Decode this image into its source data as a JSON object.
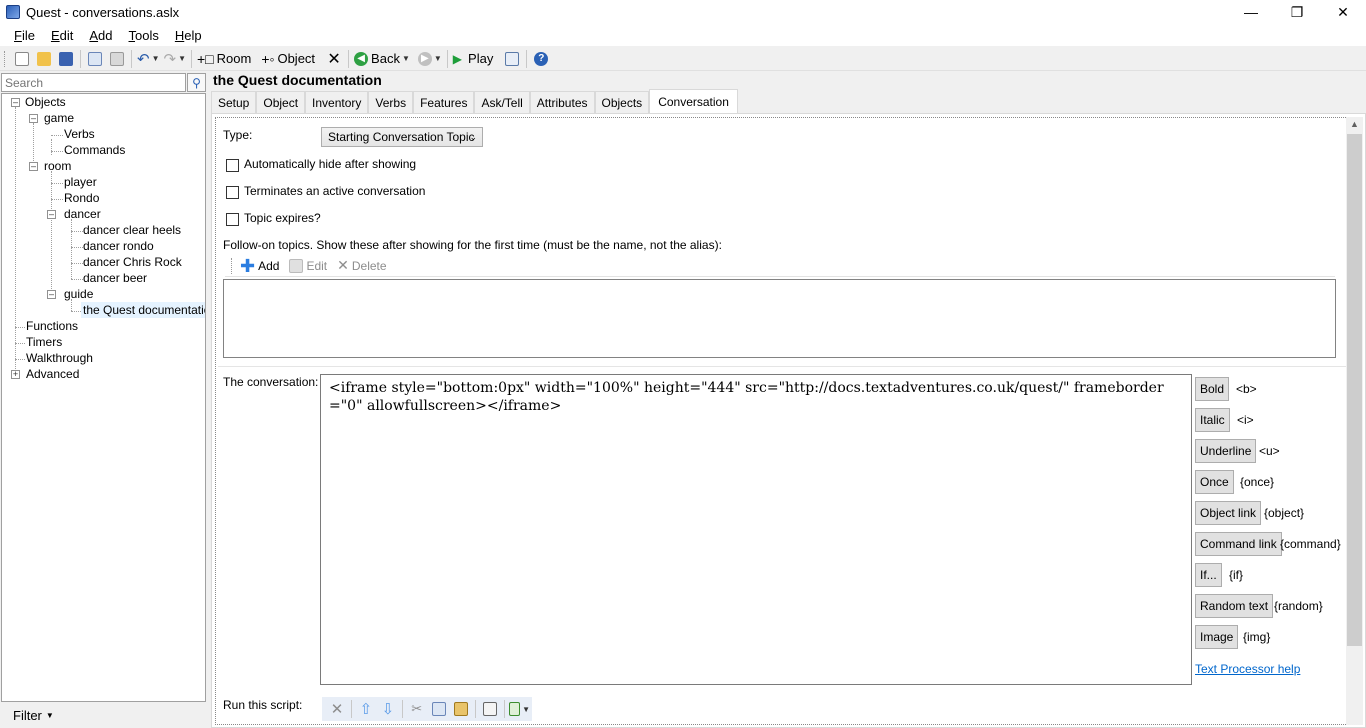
{
  "window": {
    "title": "Quest - conversations.aslx"
  },
  "menu": [
    {
      "label": "File",
      "accel": "F",
      "rest": "ile"
    },
    {
      "label": "Edit",
      "accel": "E",
      "rest": "dit"
    },
    {
      "label": "Add",
      "accel": "A",
      "rest": "dd"
    },
    {
      "label": "Tools",
      "accel": "T",
      "rest": "ools"
    },
    {
      "label": "Help",
      "accel": "H",
      "rest": "elp"
    }
  ],
  "toolbar": {
    "room_label": "Room",
    "object_label": "Object",
    "back_label": "Back",
    "play_label": "Play"
  },
  "search": {
    "placeholder": "Search"
  },
  "tree": {
    "objects": "Objects",
    "game": "game",
    "verbs": "Verbs",
    "commands": "Commands",
    "room": "room",
    "player": "player",
    "rondo": "Rondo",
    "dancer": "dancer",
    "dancer_clear_heels": "dancer clear heels",
    "dancer_rondo": "dancer rondo",
    "dancer_chris_rock": "dancer Chris Rock",
    "dancer_beer": "dancer beer",
    "guide": "guide",
    "quest_doc": "the Quest documentation",
    "functions": "Functions",
    "timers": "Timers",
    "walkthrough": "Walkthrough",
    "advanced": "Advanced"
  },
  "filter": {
    "label": "Filter"
  },
  "editor": {
    "title": "the Quest documentation",
    "tabs": [
      "Setup",
      "Object",
      "Inventory",
      "Verbs",
      "Features",
      "Ask/Tell",
      "Attributes",
      "Objects",
      "Conversation"
    ],
    "active_tab": "Conversation",
    "type_label": "Type:",
    "type_value": "Starting Conversation Topic",
    "auto_hide": "Automatically hide after showing",
    "terminates": "Terminates an active conversation",
    "expires": "Topic expires?",
    "followon": "Follow-on topics. Show these after showing for the first time (must be the name, not the alias):",
    "add": "Add",
    "edit": "Edit",
    "delete": "Delete",
    "conversation_label": "The conversation:",
    "conversation_text": "<iframe style=\"bottom:0px\" width=\"100%\" height=\"444\" src=\"http://docs.textadventures.co.uk/quest/\" frameborder=\"0\" allowfullscreen></iframe>",
    "script_label": "Run this script:",
    "help_link": "Text Processor help"
  },
  "format_buttons": [
    {
      "label": "Bold",
      "tag": "<b>"
    },
    {
      "label": "Italic",
      "tag": "<i>"
    },
    {
      "label": "Underline",
      "tag": "<u>"
    },
    {
      "label": "Once",
      "tag": "{once}"
    },
    {
      "label": "Object link",
      "tag": "{object}"
    },
    {
      "label": "Command link",
      "tag": "{command}"
    },
    {
      "label": "If...",
      "tag": "{if}"
    },
    {
      "label": "Random text",
      "tag": "{random}"
    },
    {
      "label": "Image",
      "tag": "{img}"
    }
  ],
  "icons": [
    "app-icon",
    "new-icon",
    "open-icon",
    "save-icon",
    "copy-icon",
    "paste-icon",
    "undo-icon",
    "redo-icon",
    "add-room-icon",
    "add-object-icon",
    "delete-icon",
    "back-icon",
    "forward-icon",
    "play-icon",
    "log-icon",
    "help-icon",
    "search-icon",
    "add-icon",
    "edit-icon",
    "move-up-icon",
    "move-down-icon",
    "cut-icon"
  ]
}
